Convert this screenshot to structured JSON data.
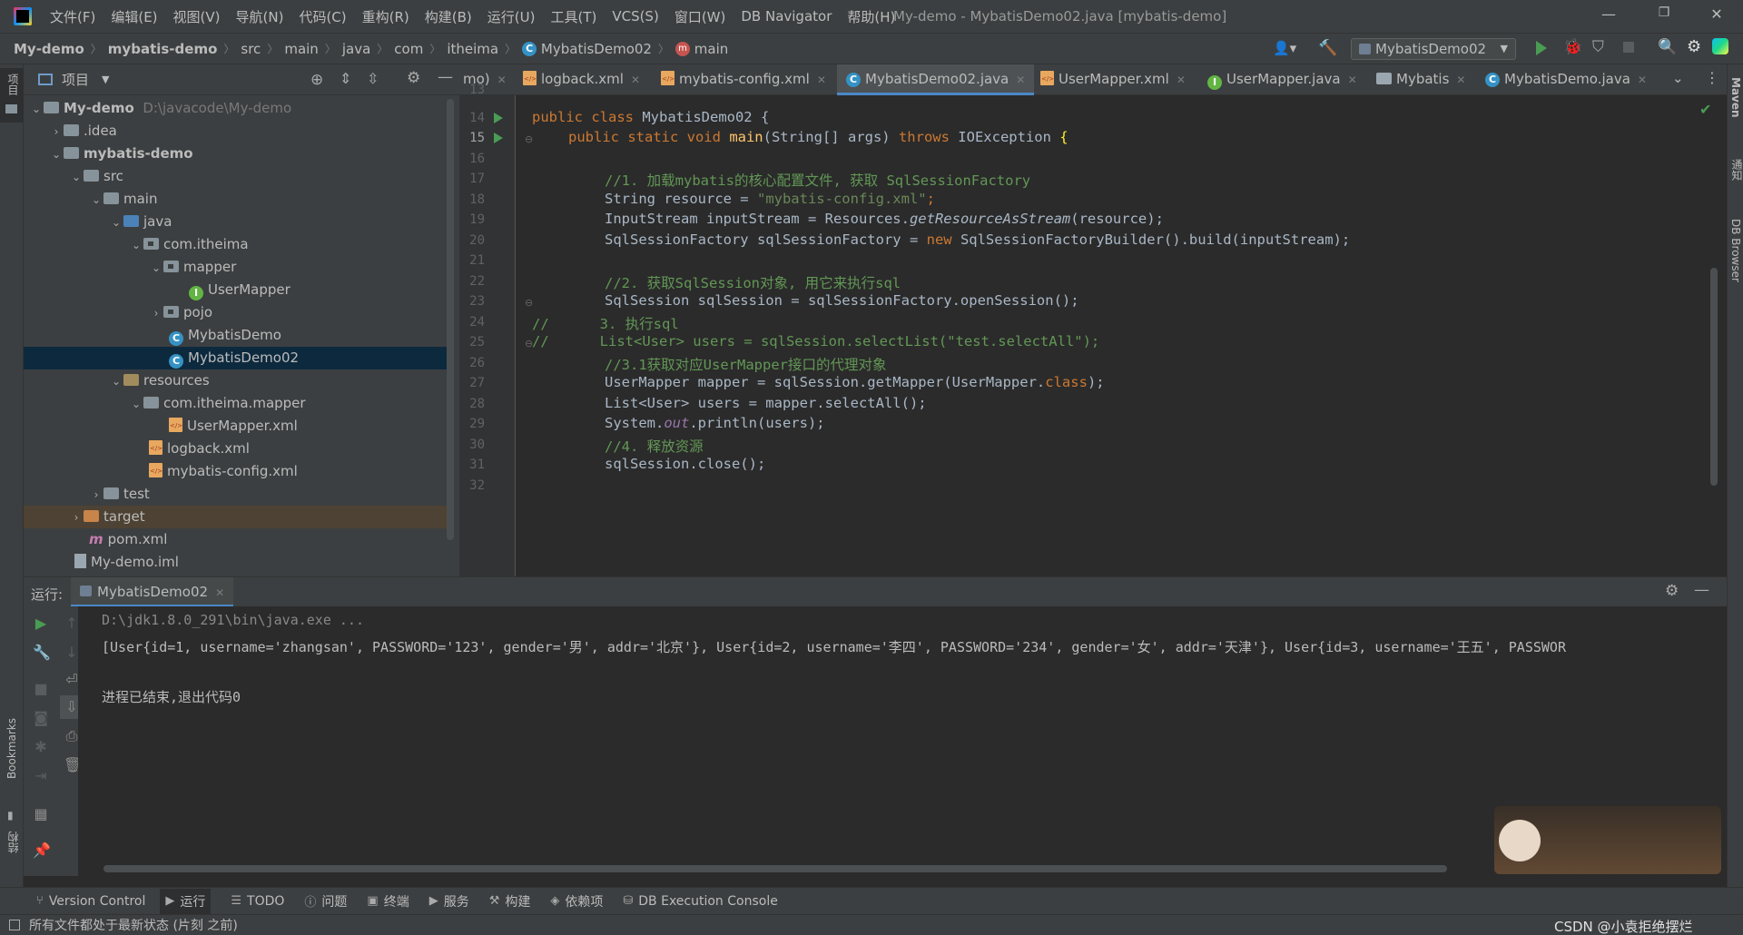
{
  "menubar": {
    "items": [
      "文件(F)",
      "编辑(E)",
      "视图(V)",
      "导航(N)",
      "代码(C)",
      "重构(R)",
      "构建(B)",
      "运行(U)",
      "工具(T)",
      "VCS(S)",
      "窗口(W)",
      "DB Navigator",
      "帮助(H)"
    ],
    "window_title": "My-demo - MybatisDemo02.java [mybatis-demo]"
  },
  "breadcrumb": {
    "items": [
      "My-demo",
      "mybatis-demo",
      "src",
      "main",
      "java",
      "com",
      "itheima",
      "MybatisDemo02",
      "main"
    ],
    "run_config": "MybatisDemo02"
  },
  "left_strip": {
    "project_label": "项目",
    "bookmarks_label": "Bookmarks",
    "structure_label": "结构"
  },
  "right_strip": {
    "maven_label": "Maven",
    "notify_label": "通知",
    "db_label": "DB Browser"
  },
  "project": {
    "header": "项目",
    "tree": [
      {
        "label": "My-demo",
        "path": "D:\\javacode\\My-demo"
      },
      {
        "label": ".idea"
      },
      {
        "label": "mybatis-demo"
      },
      {
        "label": "src"
      },
      {
        "label": "main"
      },
      {
        "label": "java"
      },
      {
        "label": "com.itheima"
      },
      {
        "label": "mapper"
      },
      {
        "label": "UserMapper"
      },
      {
        "label": "pojo"
      },
      {
        "label": "MybatisDemo"
      },
      {
        "label": "MybatisDemo02"
      },
      {
        "label": "resources"
      },
      {
        "label": "com.itheima.mapper"
      },
      {
        "label": "UserMapper.xml"
      },
      {
        "label": "logback.xml"
      },
      {
        "label": "mybatis-config.xml"
      },
      {
        "label": "test"
      },
      {
        "label": "target"
      },
      {
        "label": "pom.xml"
      },
      {
        "label": "My-demo.iml"
      }
    ]
  },
  "editor_tabs": [
    {
      "label": "mo)"
    },
    {
      "label": "logback.xml"
    },
    {
      "label": "mybatis-config.xml"
    },
    {
      "label": "MybatisDemo02.java"
    },
    {
      "label": "UserMapper.xml"
    },
    {
      "label": "UserMapper.java"
    },
    {
      "label": "Mybatis"
    },
    {
      "label": "MybatisDemo.java"
    }
  ],
  "editor": {
    "line_numbers": [
      "13",
      "14",
      "15",
      "16",
      "17",
      "18",
      "19",
      "20",
      "21",
      "22",
      "23",
      "24",
      "25",
      "26",
      "27",
      "28",
      "29",
      "30",
      "31",
      "32"
    ],
    "code": {
      "l14": [
        "public class ",
        "MybatisDemo02 {"
      ],
      "l15": [
        "public static void ",
        "main",
        "(String[] args) ",
        "throws ",
        "IOException ",
        "{"
      ],
      "l17": "//1. 加载mybatis的核心配置文件, 获取 SqlSessionFactory",
      "l18": [
        "String resource = ",
        "\"mybatis-config.xml\"",
        ";"
      ],
      "l19": [
        "InputStream inputStream = Resources.",
        "getResourceAsStream",
        "(resource);"
      ],
      "l20": [
        "SqlSessionFactory sqlSessionFactory = ",
        "new ",
        "SqlSessionFactoryBuilder().build(inputStream);"
      ],
      "l22": "//2. 获取SqlSession对象, 用它来执行sql",
      "l23": [
        "SqlSession sqlSession = sqlSessionFactory.openSession();"
      ],
      "l24": [
        "//",
        "      3. 执行sql"
      ],
      "l25": [
        "//",
        "      List<User> users = sqlSession.selectList(\"test.selectAll\");"
      ],
      "l26": "//3.1获取对应UserMapper接口的代理对象",
      "l27": [
        "UserMapper mapper = sqlSession.getMapper(UserMapper.",
        "class",
        ");"
      ],
      "l28": [
        "List<User> users = mapper.selectAll();"
      ],
      "l29": [
        "System.",
        "out",
        ".println(users);"
      ],
      "l30": "//4. 释放资源",
      "l31": [
        "sqlSession.close();"
      ]
    }
  },
  "run": {
    "label": "运行:",
    "tab": "MybatisDemo02",
    "output": [
      "D:\\jdk1.8.0_291\\bin\\java.exe ...",
      "[User{id=1, username='zhangsan', PASSWORD='123', gender='男', addr='北京'}, User{id=2, username='李四', PASSWORD='234', gender='女', addr='天津'}, User{id=3, username='王五', PASSWOR",
      "进程已结束,退出代码0"
    ]
  },
  "bottom_tools": [
    "Version Control",
    "运行",
    "TODO",
    "问题",
    "终端",
    "服务",
    "构建",
    "依赖项",
    "DB Execution Console"
  ],
  "status": {
    "message": "所有文件都处于最新状态 (片刻 之前)",
    "watermark": "CSDN @小袁拒绝摆烂"
  }
}
